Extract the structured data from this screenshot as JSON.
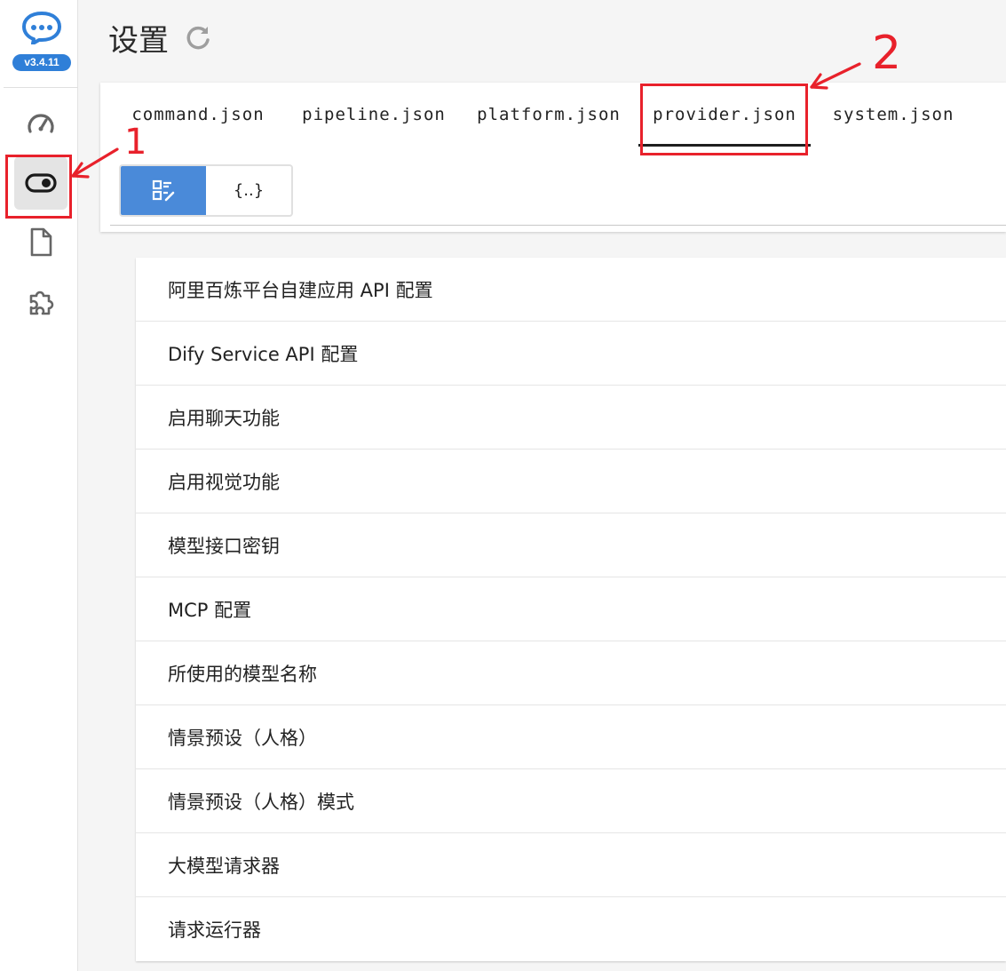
{
  "app": {
    "version": "v3.4.11"
  },
  "header": {
    "title": "设置"
  },
  "sidebar": {
    "items": [
      {
        "icon": "dashboard-gauge-icon"
      },
      {
        "icon": "toggle-switch-icon",
        "active": true
      },
      {
        "icon": "document-icon"
      },
      {
        "icon": "puzzle-plugin-icon"
      }
    ]
  },
  "tabs": [
    {
      "label": "command.json"
    },
    {
      "label": "pipeline.json"
    },
    {
      "label": "platform.json"
    },
    {
      "label": "provider.json",
      "active": true
    },
    {
      "label": "system.json"
    }
  ],
  "view_toggle": {
    "form_icon": "form-view-icon",
    "json_label": "{..}",
    "active": "form"
  },
  "settings_list": [
    {
      "label": "阿里百炼平台自建应用 API 配置"
    },
    {
      "label": "Dify Service API 配置"
    },
    {
      "label": "启用聊天功能"
    },
    {
      "label": "启用视觉功能"
    },
    {
      "label": "模型接口密钥"
    },
    {
      "label": "MCP 配置"
    },
    {
      "label": "所使用的模型名称"
    },
    {
      "label": "情景预设（人格）"
    },
    {
      "label": "情景预设（人格）模式"
    },
    {
      "label": "大模型请求器"
    },
    {
      "label": "请求运行器"
    }
  ],
  "annotations": [
    {
      "label": "1"
    },
    {
      "label": "2"
    }
  ],
  "colors": {
    "accent": "#4a8ad9",
    "annotation": "#e8212b",
    "badge": "#2f7fd8"
  }
}
